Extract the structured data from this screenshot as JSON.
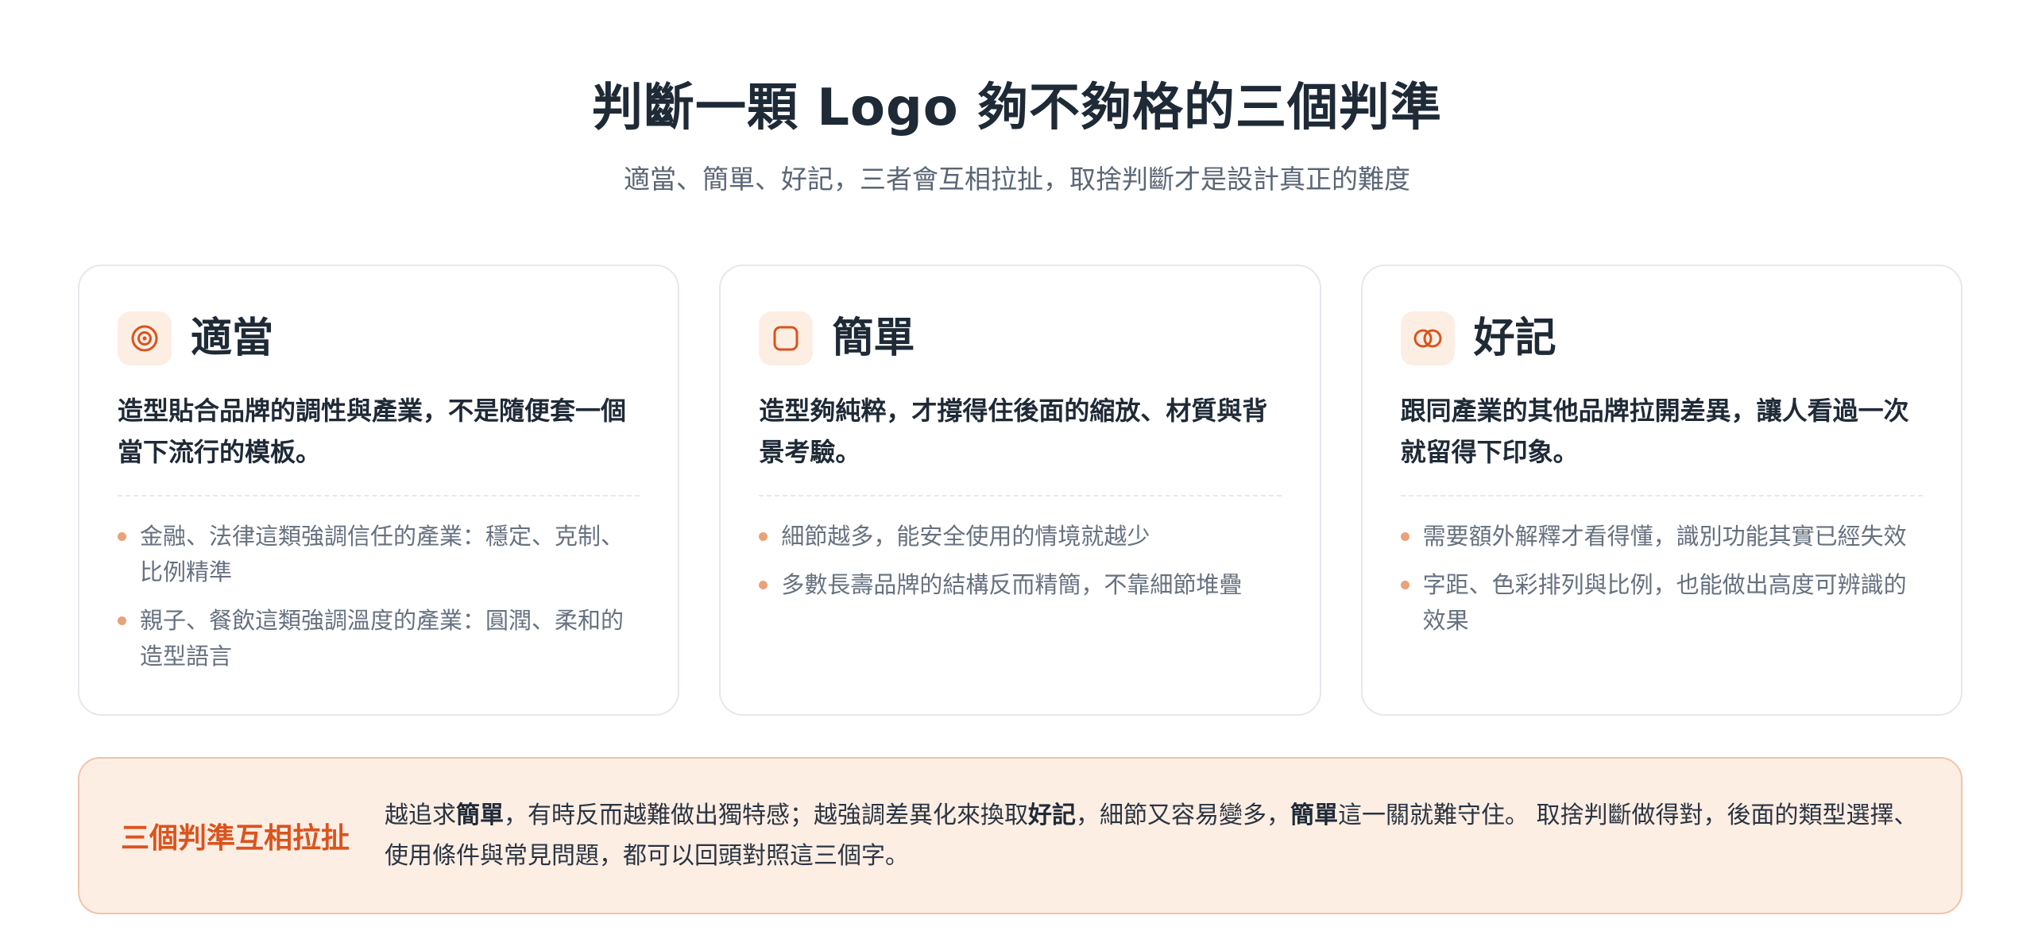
{
  "header": {
    "title": "判斷一顆 Logo 夠不夠格的三個判準",
    "subtitle": "適當、簡單、好記，三者會互相拉扯，取捨判斷才是設計真正的難度"
  },
  "cards": [
    {
      "icon": "target-icon",
      "title": "適當",
      "lead": "造型貼合品牌的調性與產業，不是隨便套一個當下流行的模板。",
      "bullets": [
        "金融、法律這類強調信任的產業：穩定、克制、比例精準",
        "親子、餐飲這類強調溫度的產業：圓潤、柔和的造型語言"
      ]
    },
    {
      "icon": "rounded-square-icon",
      "title": "簡單",
      "lead": "造型夠純粹，才撐得住後面的縮放、材質與背景考驗。",
      "bullets": [
        "細節越多，能安全使用的情境就越少",
        "多數長壽品牌的結構反而精簡，不靠細節堆疊"
      ]
    },
    {
      "icon": "interlocking-rings-icon",
      "title": "好記",
      "lead": "跟同產業的其他品牌拉開差異，讓人看過一次就留得下印象。",
      "bullets": [
        "需要額外解釋才看得懂，識別功能其實已經失效",
        "字距、色彩排列與比例，也能做出高度可辨識的效果"
      ]
    }
  ],
  "banner": {
    "title": "三個判準互相拉扯",
    "t1": "越追求",
    "b1": "簡單",
    "t2": "，有時反而越難做出獨特感；越強調差異化來換取",
    "b2": "好記",
    "t3": "，細節又容易變多，",
    "b3": "簡單",
    "t4": "這一關就難守住。 取捨判斷做得對，後面的類型選擇、使用條件與常見問題，都可以回頭對照這三個字。"
  },
  "colors": {
    "accent": "#d9541e",
    "icon_bg": "#fdeee4",
    "bullet_dot": "#e9a27a",
    "banner_bg": "#fdeee4",
    "banner_border": "#f0c4aa"
  }
}
